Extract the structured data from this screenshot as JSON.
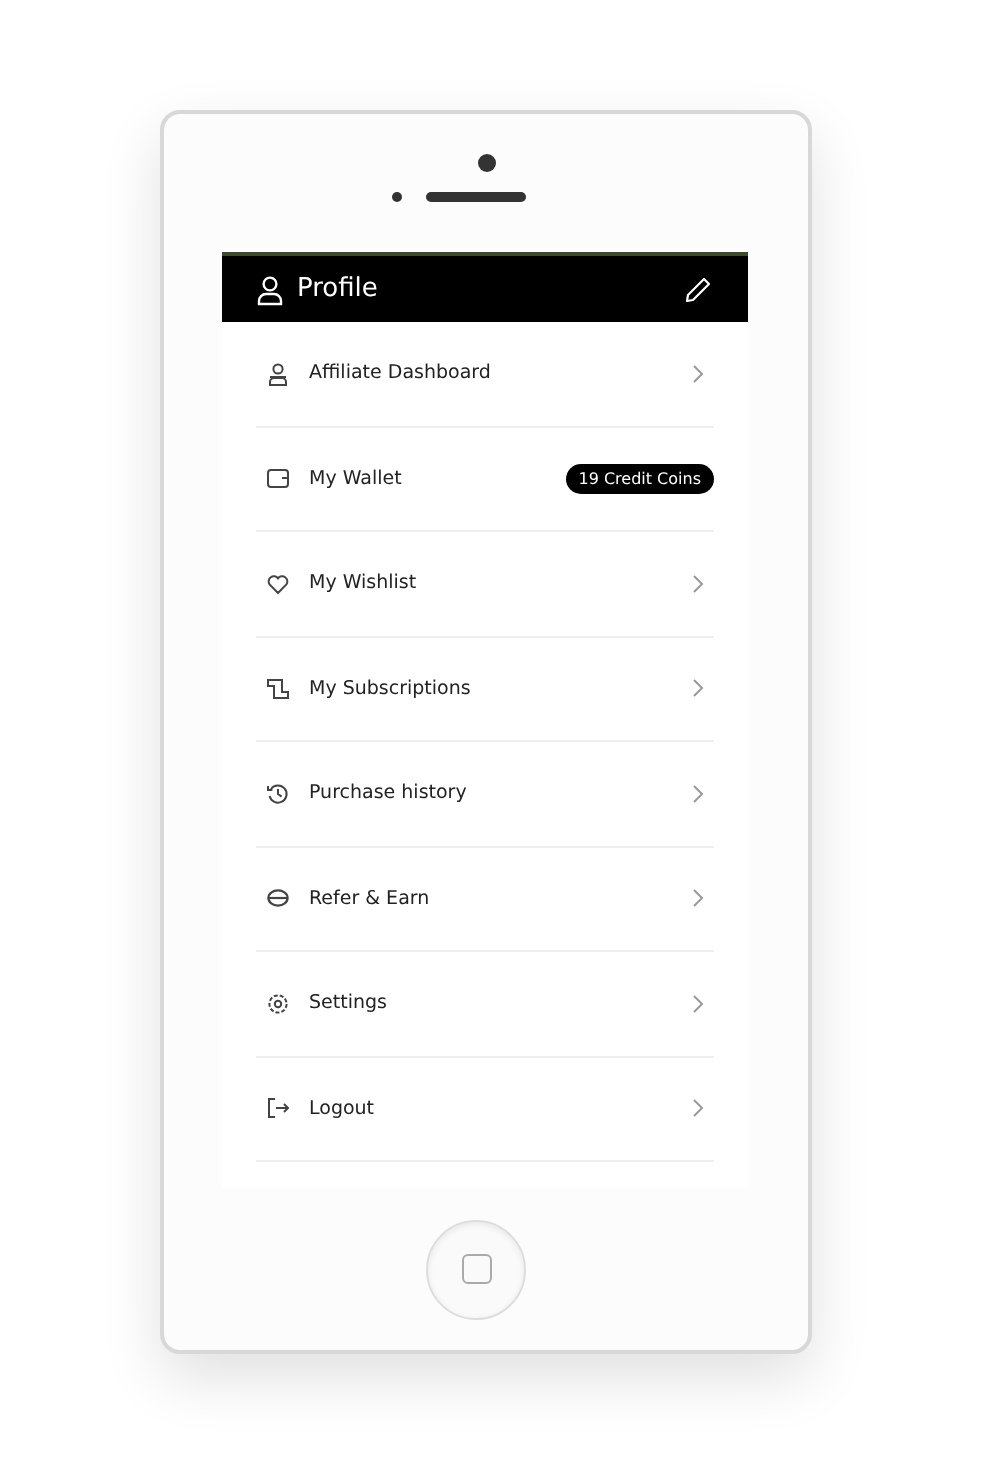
{
  "header": {
    "title": "Profile"
  },
  "menu": [
    {
      "kind": "link",
      "label": "Affiliate Dashboard"
    },
    {
      "kind": "badge",
      "label": "My Wallet",
      "badge": "19 Credit Coins"
    },
    {
      "kind": "link",
      "label": "My Wishlist"
    },
    {
      "kind": "link",
      "label": "My Subscriptions"
    },
    {
      "kind": "link",
      "label": "Purchase history"
    },
    {
      "kind": "link",
      "label": "Refer & Earn"
    },
    {
      "kind": "link",
      "label": "Settings"
    },
    {
      "kind": "link",
      "label": "Logout"
    }
  ]
}
